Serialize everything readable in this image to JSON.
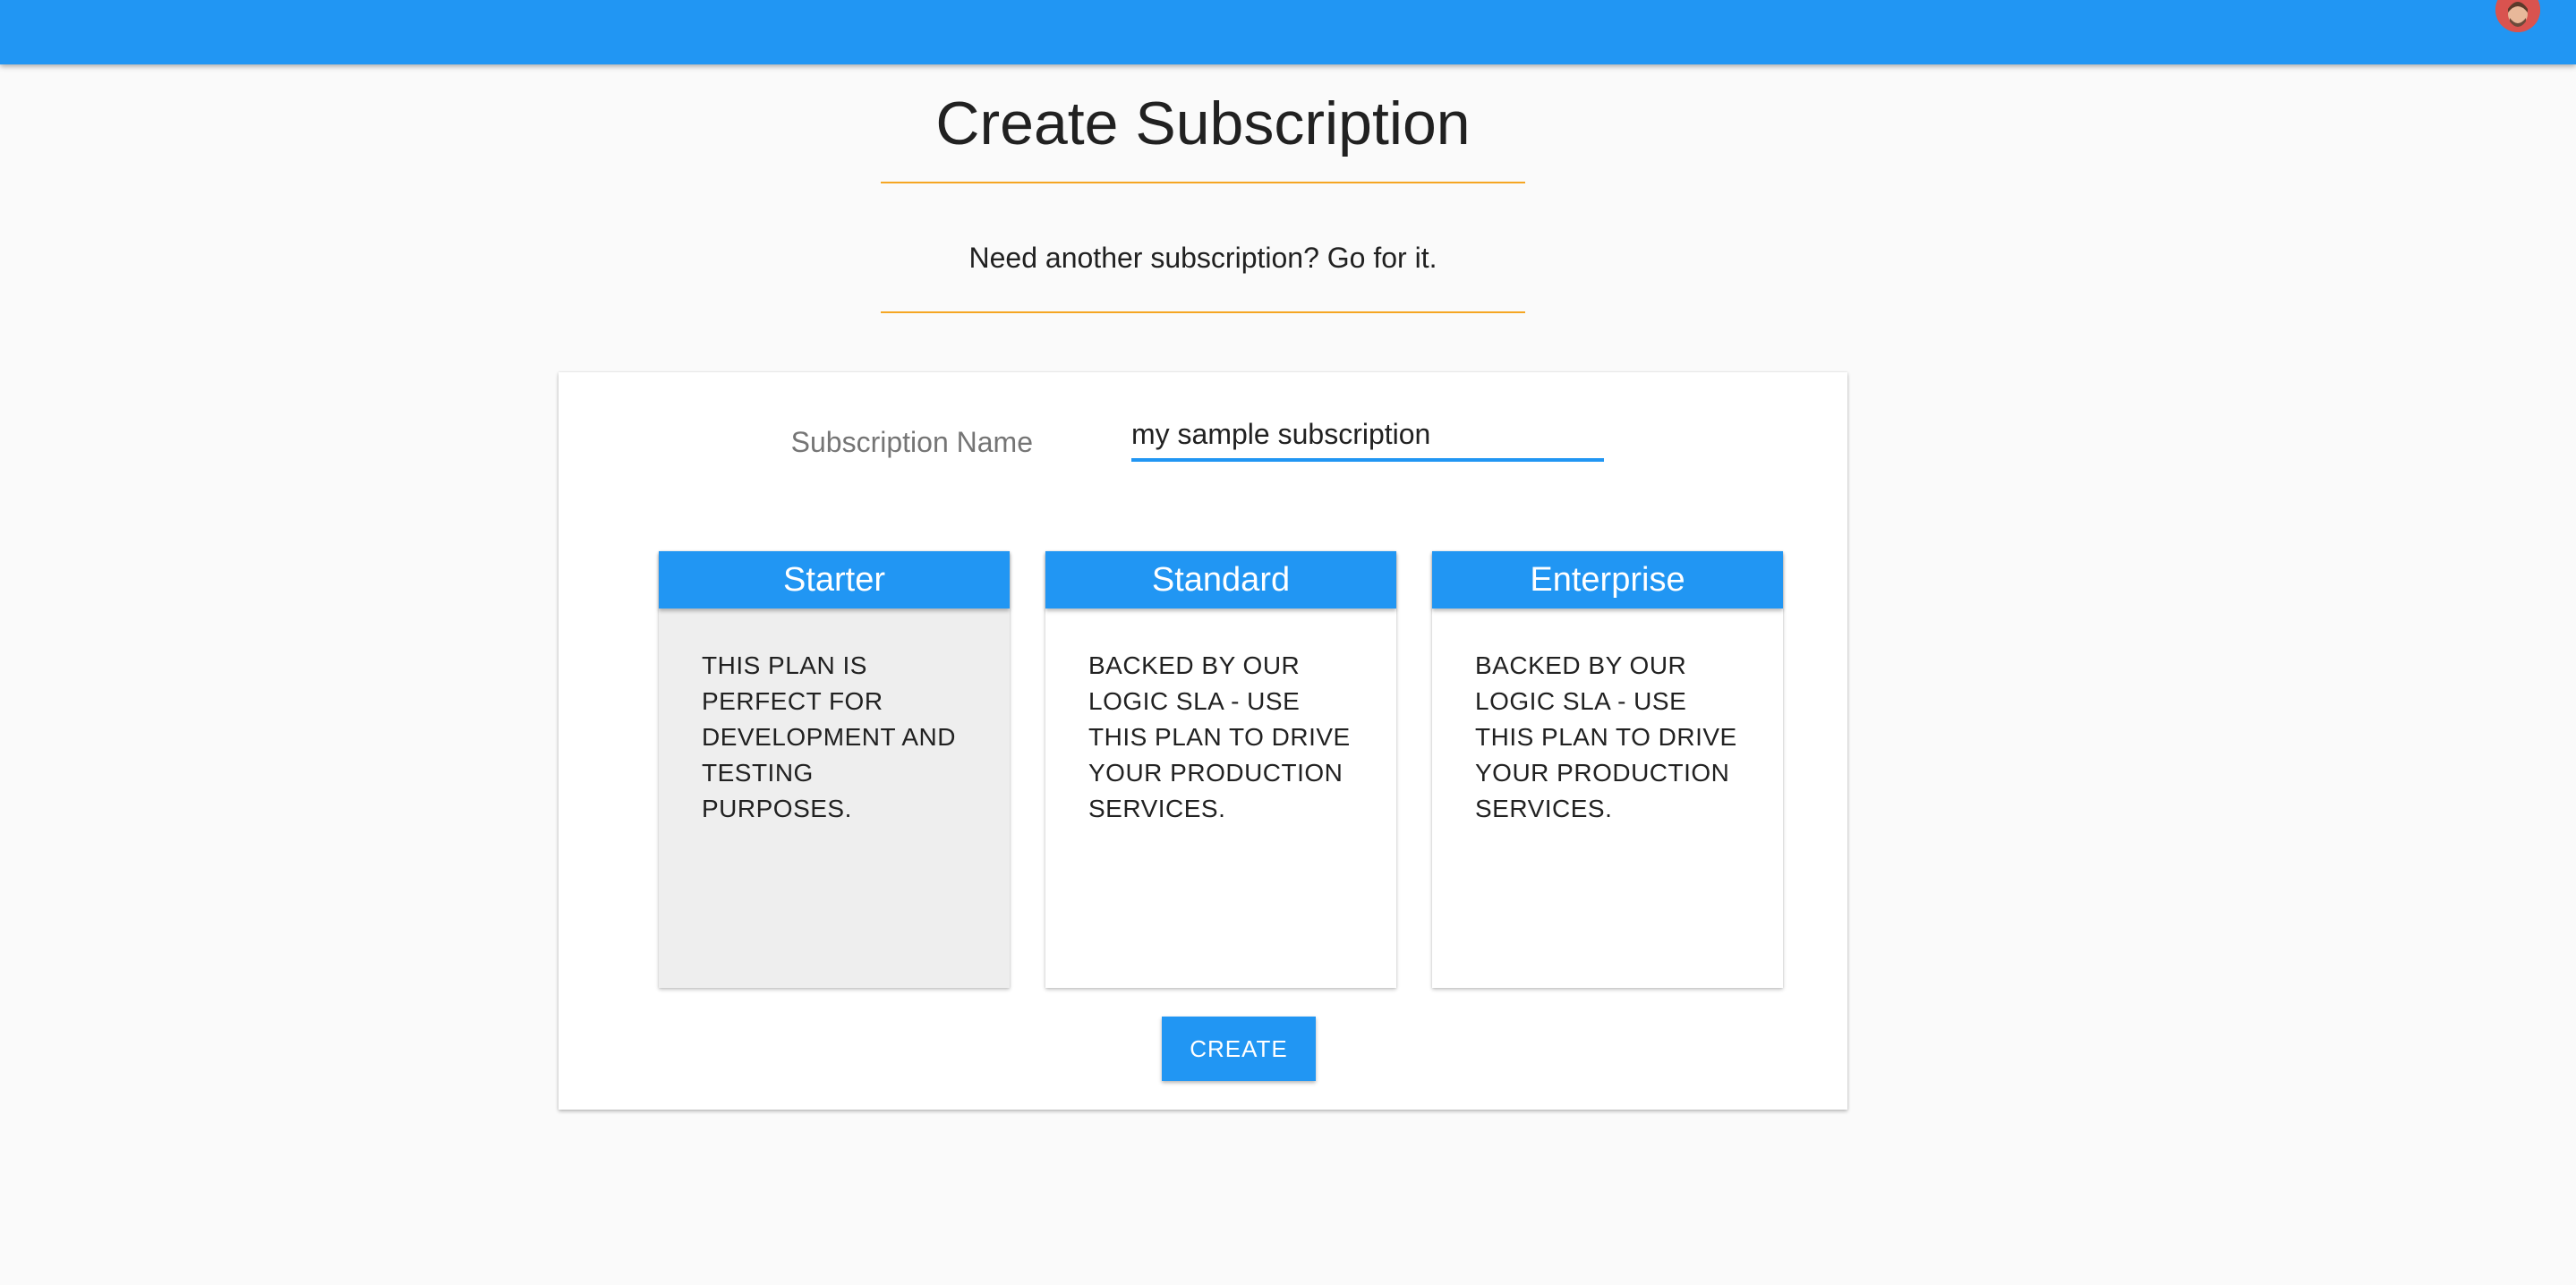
{
  "header": {
    "color": "#2196f3",
    "avatar_icon": "user-avatar"
  },
  "page": {
    "title": "Create Subscription",
    "subtitle": "Need another subscription? Go for it.",
    "accent_color": "#f5a623"
  },
  "form": {
    "name_label": "Subscription Name",
    "name_value": "my sample subscription",
    "plans": [
      {
        "name": "Starter",
        "description": "THIS PLAN IS PERFECT FOR DEVELOPMENT AND TESTING PURPOSES.",
        "selected": true
      },
      {
        "name": "Standard",
        "description": "BACKED BY OUR LOGIC SLA - USE THIS PLAN TO DRIVE YOUR PRODUCTION SERVICES.",
        "selected": false
      },
      {
        "name": "Enterprise",
        "description": "BACKED BY OUR LOGIC SLA - USE THIS PLAN TO DRIVE YOUR PRODUCTION SERVICES.",
        "selected": false
      }
    ],
    "create_label": "CREATE"
  }
}
